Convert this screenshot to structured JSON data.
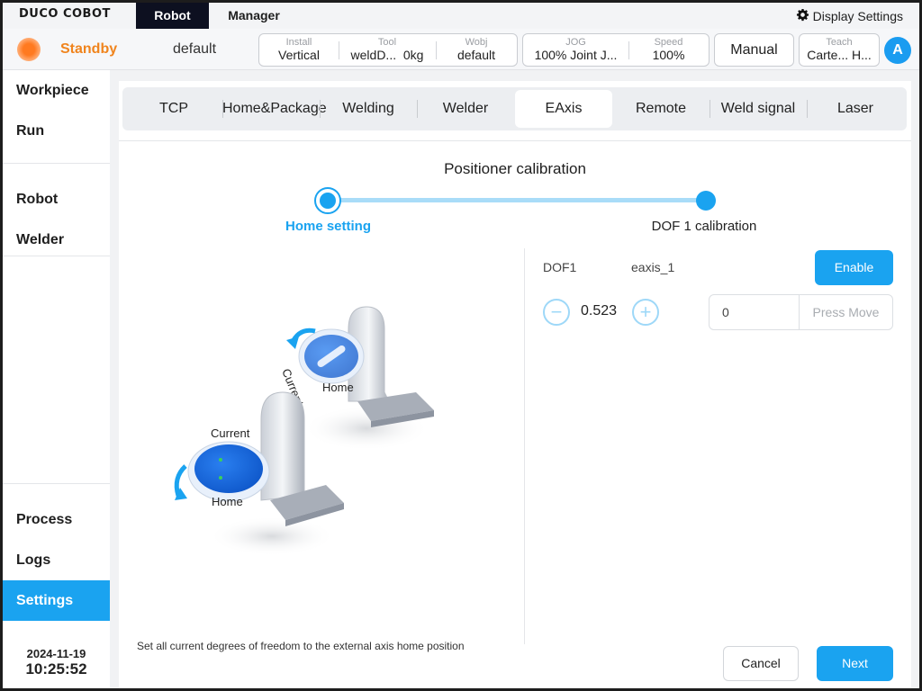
{
  "app": {
    "logo": "DUCO COBOT",
    "tabs": [
      "Robot",
      "Manager"
    ],
    "display_settings": "Display Settings"
  },
  "status": {
    "state": "Standby",
    "project": "default",
    "install": {
      "label": "Install",
      "value": "Vertical"
    },
    "tool": {
      "label": "Tool",
      "value": "weldD...",
      "weight": "0kg"
    },
    "wobj": {
      "label": "Wobj",
      "value": "default"
    },
    "jog": {
      "label": "JOG",
      "value": "100% Joint J..."
    },
    "speed": {
      "label": "Speed",
      "value": "100%"
    },
    "mode": "Manual",
    "teach": {
      "label": "Teach",
      "value": "Carte...",
      "value2": "H..."
    },
    "user_initial": "A"
  },
  "sidebar": {
    "items": [
      "Workpiece",
      "Run",
      "Robot",
      "Welder",
      "Process",
      "Logs",
      "Settings"
    ],
    "active": "Settings",
    "date": "2024-11-19",
    "time": "10:25:52"
  },
  "settings_tabs": [
    "TCP",
    "Home&Package",
    "Welding",
    "Welder",
    "EAxis",
    "Remote",
    "Weld signal",
    "Laser"
  ],
  "active_tab": "EAxis",
  "calibration": {
    "title": "Positioner calibration",
    "steps": [
      "Home setting",
      "DOF 1 calibration"
    ],
    "current_step": 0,
    "illustration": {
      "label_current_1": "Current",
      "label_home_1": "Home",
      "label_current_2": "Current",
      "label_home_2": "Home"
    },
    "dof_label": "DOF1",
    "axis_name": "eaxis_1",
    "enable_label": "Enable",
    "value": "0.523",
    "move_input": "0",
    "press_move_label": "Press Move",
    "hint": "Set all current degrees of freedom to the external axis home position",
    "cancel_label": "Cancel",
    "next_label": "Next"
  },
  "colors": {
    "accent": "#1aa3f0",
    "standby": "#f0841d",
    "dark_tab": "#0d1020"
  }
}
